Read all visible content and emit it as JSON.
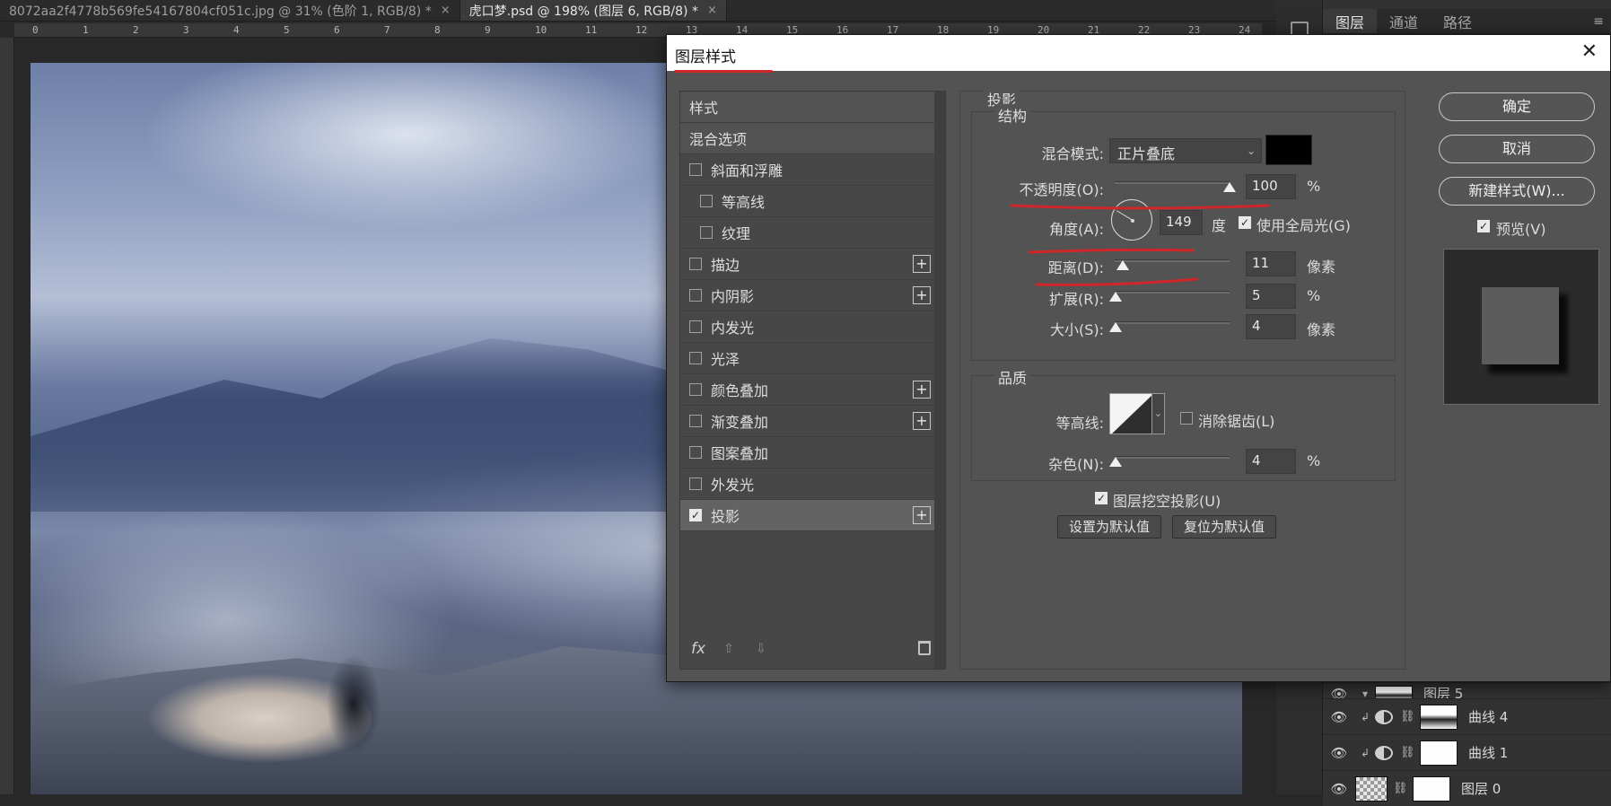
{
  "doc_tabs": [
    {
      "label": "8072aa2f4778b569fe54167804cf051c.jpg @ 31% (色阶 1, RGB/8) *",
      "close": "×"
    },
    {
      "label": "虎口梦.psd @ 198% (图层 6, RGB/8) *",
      "close": "×"
    }
  ],
  "ruler": [
    "0",
    "1",
    "2",
    "3",
    "4",
    "5",
    "6",
    "7",
    "8",
    "9",
    "10",
    "11",
    "12",
    "13",
    "14",
    "15",
    "16",
    "17",
    "18",
    "19",
    "20",
    "21",
    "22",
    "23",
    "24"
  ],
  "panel": {
    "tabs": [
      "图层",
      "通道",
      "路径"
    ],
    "menu_icon": "≡",
    "layers": [
      {
        "name": "图层 5"
      },
      {
        "name": "曲线 4"
      },
      {
        "name": "曲线 1"
      },
      {
        "name": "图层 0"
      }
    ]
  },
  "dialog": {
    "title": "图层样式",
    "close": "✕",
    "styles": {
      "header": "样式",
      "blend_options": "混合选项",
      "items": [
        {
          "label": "斜面和浮雕",
          "checked": false,
          "plus": false,
          "indent": false
        },
        {
          "label": "等高线",
          "checked": false,
          "plus": false,
          "indent": true
        },
        {
          "label": "纹理",
          "checked": false,
          "plus": false,
          "indent": true
        },
        {
          "label": "描边",
          "checked": false,
          "plus": true,
          "indent": false
        },
        {
          "label": "内阴影",
          "checked": false,
          "plus": true,
          "indent": false
        },
        {
          "label": "内发光",
          "checked": false,
          "plus": false,
          "indent": false
        },
        {
          "label": "光泽",
          "checked": false,
          "plus": false,
          "indent": false
        },
        {
          "label": "颜色叠加",
          "checked": false,
          "plus": true,
          "indent": false
        },
        {
          "label": "渐变叠加",
          "checked": false,
          "plus": true,
          "indent": false
        },
        {
          "label": "图案叠加",
          "checked": false,
          "plus": false,
          "indent": false
        },
        {
          "label": "外发光",
          "checked": false,
          "plus": false,
          "indent": false
        },
        {
          "label": "投影",
          "checked": true,
          "plus": true,
          "indent": false,
          "selected": true
        }
      ],
      "footer": {
        "fx": "fx",
        "up": "⇧",
        "down": "⇩"
      }
    },
    "settings": {
      "title": "投影",
      "structure": {
        "title": "结构",
        "blend_mode_label": "混合模式:",
        "blend_mode_value": "正片叠底",
        "shadow_color": "#000000",
        "opacity_label": "不透明度(O):",
        "opacity_value": "100",
        "opacity_unit": "%",
        "opacity_level": 1.0,
        "angle_label": "角度(A):",
        "angle_value": "149",
        "angle_unit": "度",
        "global_light_label": "使用全局光(G)",
        "global_light_checked": true,
        "distance_label": "距离(D):",
        "distance_value": "11",
        "distance_unit": "像素",
        "spread_label": "扩展(R):",
        "spread_value": "5",
        "spread_unit": "%",
        "size_label": "大小(S):",
        "size_value": "4",
        "size_unit": "像素"
      },
      "quality": {
        "title": "品质",
        "contour_label": "等高线:",
        "antialias_label": "消除锯齿(L)",
        "antialias_checked": false,
        "noise_label": "杂色(N):",
        "noise_value": "4",
        "noise_unit": "%"
      },
      "knockout_label": "图层挖空投影(U)",
      "knockout_checked": true,
      "make_default": "设置为默认值",
      "reset_default": "复位为默认值"
    },
    "buttons": {
      "ok": "确定",
      "cancel": "取消",
      "new_style": "新建样式(W)...",
      "preview_label": "预览(V)",
      "preview_checked": true
    }
  },
  "annotation_color": "#d0262a"
}
